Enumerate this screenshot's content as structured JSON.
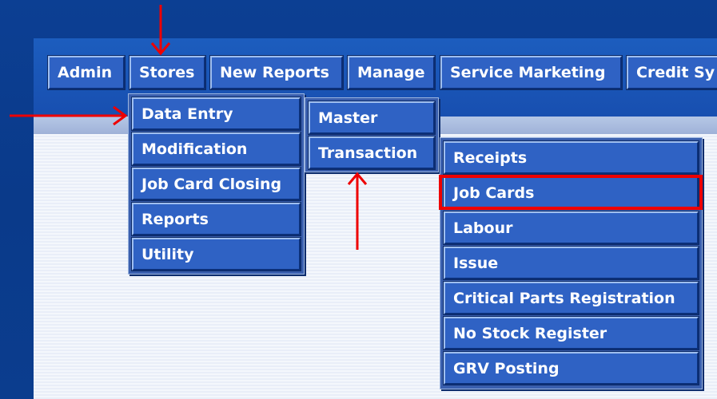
{
  "menubar": {
    "items": [
      {
        "label": "Admin"
      },
      {
        "label": "Stores"
      },
      {
        "label": "New Reports"
      },
      {
        "label": "Manage"
      },
      {
        "label": "Service Marketing"
      },
      {
        "label": "Credit Sy"
      }
    ]
  },
  "stores_menu": {
    "items": [
      {
        "label": "Data Entry"
      },
      {
        "label": "Modification"
      },
      {
        "label": "Job Card Closing"
      },
      {
        "label": "Reports"
      },
      {
        "label": "Utility"
      }
    ]
  },
  "data_entry_menu": {
    "items": [
      {
        "label": "Master"
      },
      {
        "label": "Transaction"
      }
    ]
  },
  "transaction_menu": {
    "items": [
      {
        "label": "Receipts"
      },
      {
        "label": "Job Cards"
      },
      {
        "label": "Labour"
      },
      {
        "label": "Issue"
      },
      {
        "label": "Critical Parts Registration"
      },
      {
        "label": "No Stock Register"
      },
      {
        "label": "GRV Posting"
      }
    ]
  },
  "colors": {
    "annotation_red": "#ee0000",
    "menu_blue": "#2f62c4",
    "background_blue": "#0c3f93"
  }
}
